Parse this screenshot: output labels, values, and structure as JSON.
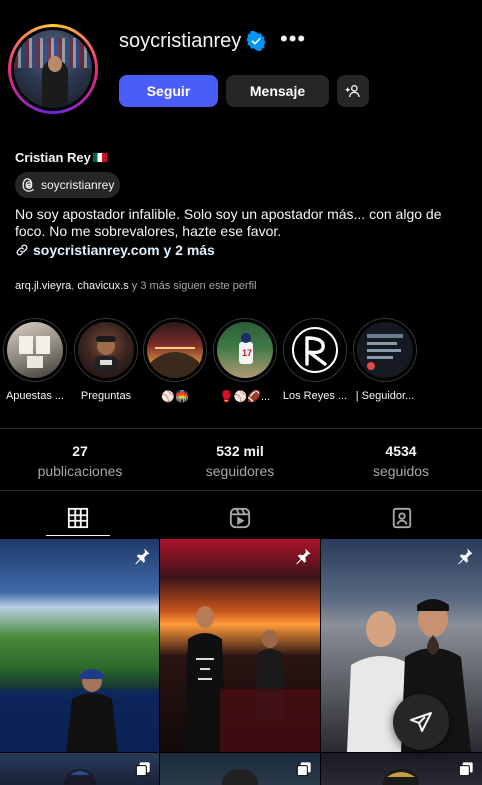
{
  "profile": {
    "username": "soycristianrey",
    "follow_label": "Seguir",
    "message_label": "Mensaje",
    "full_name": "Cristian Rey",
    "threads_handle": "soycristianrey",
    "bio_line1": "No soy apostador infalible. Solo soy un apostador más... con algo de",
    "bio_line2": "foco. No me sobrevalores, hazte ese favor.",
    "link_text": "soycristianrey.com y 2 más",
    "followed_by_users": "arq.jl.vieyra",
    "followed_by_sep": ", ",
    "followed_by_user2": "chavicux.s",
    "followed_by_rest": " y 3 más siguen este perfil"
  },
  "highlights": [
    {
      "label": "Apuestas ..."
    },
    {
      "label": "Preguntas"
    },
    {
      "label": "⚾🏟️"
    },
    {
      "label": "🥊⚾🏈..."
    },
    {
      "label": "Los Reyes ..."
    },
    {
      "label": "| Seguidor..."
    }
  ],
  "stats": {
    "posts_num": "27",
    "posts_label": "publicaciones",
    "followers_num": "532 mil",
    "followers_label": "seguidores",
    "following_num": "4534",
    "following_label": "seguidos"
  },
  "tabs": [
    "grid-icon",
    "reels-icon",
    "tagged-icon"
  ],
  "colors": {
    "follow_button": "#4a5df9",
    "secondary_button": "#262626",
    "verified": "#0095f6",
    "link": "#e0f1ff"
  }
}
